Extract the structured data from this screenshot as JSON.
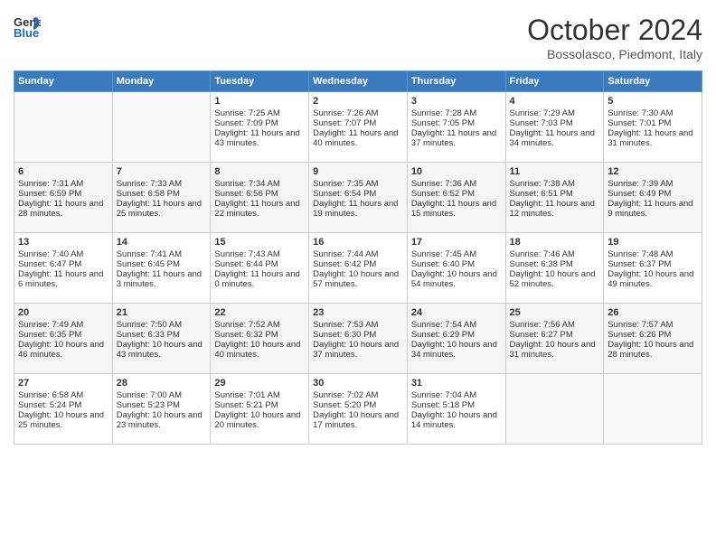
{
  "header": {
    "logo_general": "General",
    "logo_blue": "Blue",
    "month_title": "October 2024",
    "location": "Bossolasco, Piedmont, Italy"
  },
  "days_of_week": [
    "Sunday",
    "Monday",
    "Tuesday",
    "Wednesday",
    "Thursday",
    "Friday",
    "Saturday"
  ],
  "weeks": [
    [
      {
        "day": "",
        "info": ""
      },
      {
        "day": "",
        "info": ""
      },
      {
        "day": "1",
        "info": "Sunrise: 7:25 AM\nSunset: 7:09 PM\nDaylight: 11 hours and 43 minutes."
      },
      {
        "day": "2",
        "info": "Sunrise: 7:26 AM\nSunset: 7:07 PM\nDaylight: 11 hours and 40 minutes."
      },
      {
        "day": "3",
        "info": "Sunrise: 7:28 AM\nSunset: 7:05 PM\nDaylight: 11 hours and 37 minutes."
      },
      {
        "day": "4",
        "info": "Sunrise: 7:29 AM\nSunset: 7:03 PM\nDaylight: 11 hours and 34 minutes."
      },
      {
        "day": "5",
        "info": "Sunrise: 7:30 AM\nSunset: 7:01 PM\nDaylight: 11 hours and 31 minutes."
      }
    ],
    [
      {
        "day": "6",
        "info": "Sunrise: 7:31 AM\nSunset: 6:59 PM\nDaylight: 11 hours and 28 minutes."
      },
      {
        "day": "7",
        "info": "Sunrise: 7:33 AM\nSunset: 6:58 PM\nDaylight: 11 hours and 25 minutes."
      },
      {
        "day": "8",
        "info": "Sunrise: 7:34 AM\nSunset: 6:56 PM\nDaylight: 11 hours and 22 minutes."
      },
      {
        "day": "9",
        "info": "Sunrise: 7:35 AM\nSunset: 6:54 PM\nDaylight: 11 hours and 19 minutes."
      },
      {
        "day": "10",
        "info": "Sunrise: 7:36 AM\nSunset: 6:52 PM\nDaylight: 11 hours and 15 minutes."
      },
      {
        "day": "11",
        "info": "Sunrise: 7:38 AM\nSunset: 6:51 PM\nDaylight: 11 hours and 12 minutes."
      },
      {
        "day": "12",
        "info": "Sunrise: 7:39 AM\nSunset: 6:49 PM\nDaylight: 11 hours and 9 minutes."
      }
    ],
    [
      {
        "day": "13",
        "info": "Sunrise: 7:40 AM\nSunset: 6:47 PM\nDaylight: 11 hours and 6 minutes."
      },
      {
        "day": "14",
        "info": "Sunrise: 7:41 AM\nSunset: 6:45 PM\nDaylight: 11 hours and 3 minutes."
      },
      {
        "day": "15",
        "info": "Sunrise: 7:43 AM\nSunset: 6:44 PM\nDaylight: 11 hours and 0 minutes."
      },
      {
        "day": "16",
        "info": "Sunrise: 7:44 AM\nSunset: 6:42 PM\nDaylight: 10 hours and 57 minutes."
      },
      {
        "day": "17",
        "info": "Sunrise: 7:45 AM\nSunset: 6:40 PM\nDaylight: 10 hours and 54 minutes."
      },
      {
        "day": "18",
        "info": "Sunrise: 7:46 AM\nSunset: 6:38 PM\nDaylight: 10 hours and 52 minutes."
      },
      {
        "day": "19",
        "info": "Sunrise: 7:48 AM\nSunset: 6:37 PM\nDaylight: 10 hours and 49 minutes."
      }
    ],
    [
      {
        "day": "20",
        "info": "Sunrise: 7:49 AM\nSunset: 6:35 PM\nDaylight: 10 hours and 46 minutes."
      },
      {
        "day": "21",
        "info": "Sunrise: 7:50 AM\nSunset: 6:33 PM\nDaylight: 10 hours and 43 minutes."
      },
      {
        "day": "22",
        "info": "Sunrise: 7:52 AM\nSunset: 6:32 PM\nDaylight: 10 hours and 40 minutes."
      },
      {
        "day": "23",
        "info": "Sunrise: 7:53 AM\nSunset: 6:30 PM\nDaylight: 10 hours and 37 minutes."
      },
      {
        "day": "24",
        "info": "Sunrise: 7:54 AM\nSunset: 6:29 PM\nDaylight: 10 hours and 34 minutes."
      },
      {
        "day": "25",
        "info": "Sunrise: 7:56 AM\nSunset: 6:27 PM\nDaylight: 10 hours and 31 minutes."
      },
      {
        "day": "26",
        "info": "Sunrise: 7:57 AM\nSunset: 6:26 PM\nDaylight: 10 hours and 28 minutes."
      }
    ],
    [
      {
        "day": "27",
        "info": "Sunrise: 6:58 AM\nSunset: 5:24 PM\nDaylight: 10 hours and 25 minutes."
      },
      {
        "day": "28",
        "info": "Sunrise: 7:00 AM\nSunset: 5:23 PM\nDaylight: 10 hours and 23 minutes."
      },
      {
        "day": "29",
        "info": "Sunrise: 7:01 AM\nSunset: 5:21 PM\nDaylight: 10 hours and 20 minutes."
      },
      {
        "day": "30",
        "info": "Sunrise: 7:02 AM\nSunset: 5:20 PM\nDaylight: 10 hours and 17 minutes."
      },
      {
        "day": "31",
        "info": "Sunrise: 7:04 AM\nSunset: 5:18 PM\nDaylight: 10 hours and 14 minutes."
      },
      {
        "day": "",
        "info": ""
      },
      {
        "day": "",
        "info": ""
      }
    ]
  ]
}
